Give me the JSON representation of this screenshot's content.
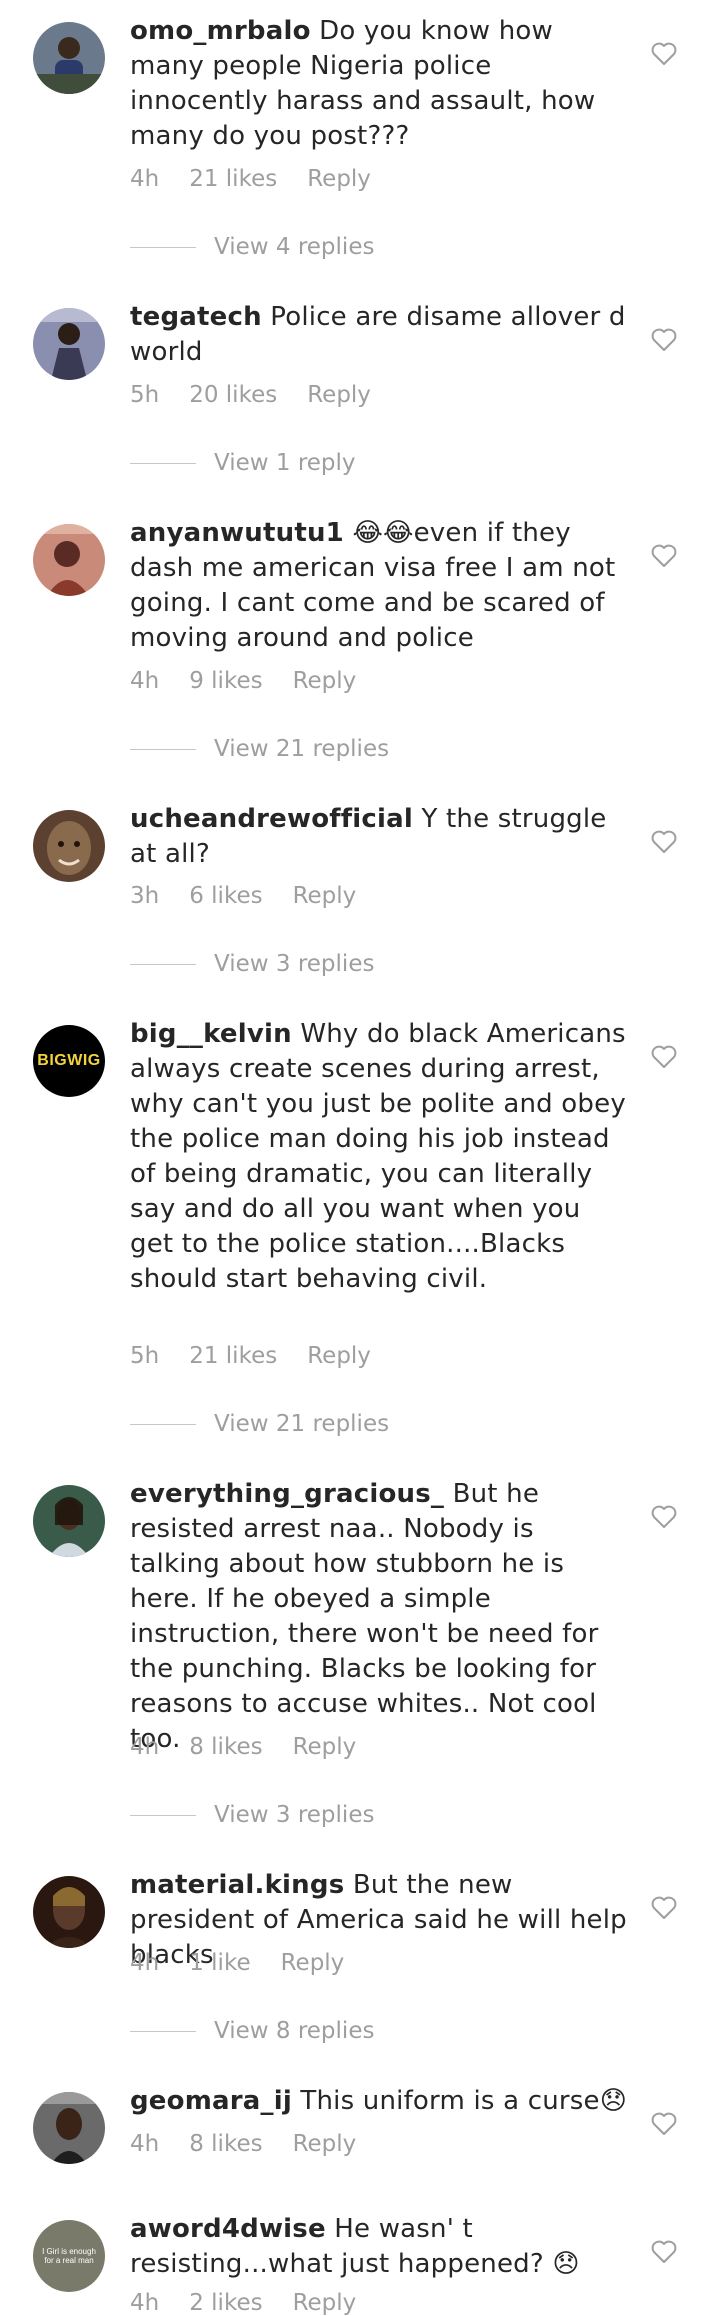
{
  "comments": [
    {
      "username": "omo_mrbalo",
      "text": "Do you know how many people Nigeria police innocently harass and assault, how many do you post???",
      "time": "4h",
      "likes": "21 likes",
      "reply": "Reply",
      "view_replies": "View 4 replies",
      "avatar": {
        "bg": "#6a7a8c",
        "fg": "#2b3a6b"
      }
    },
    {
      "username": "tegatech",
      "text": "Police are disame allover d world",
      "time": "5h",
      "likes": "20 likes",
      "reply": "Reply",
      "view_replies": "View 1 reply",
      "avatar": {
        "bg": "#8a8fb0",
        "fg": "#3b3a55"
      }
    },
    {
      "username": "anyanwututu1",
      "text": "😂😂even if they dash me american visa free I am not going. I cant come and be scared of moving around and police",
      "time": "4h",
      "likes": "9 likes",
      "reply": "Reply",
      "view_replies": "View 21 replies",
      "avatar": {
        "bg": "#c98a7a",
        "fg": "#5a2b25"
      }
    },
    {
      "username": "ucheandrewofficial",
      "text": "Y the struggle at all?",
      "time": "3h",
      "likes": "6 likes",
      "reply": "Reply",
      "view_replies": "View 3 replies",
      "avatar": {
        "bg": "#8a6a4c",
        "fg": "#3a2718"
      }
    },
    {
      "username": "big__kelvin",
      "text": "Why do black Americans always create scenes during arrest, why can't you just be polite and obey the police man doing his job instead of being dramatic, you can literally say and do all you want when you get to the police station....Blacks should start behaving civil.",
      "time": "5h",
      "likes": "21 likes",
      "reply": "Reply",
      "view_replies": "View 21 replies",
      "avatar": {
        "bg": "#000000",
        "fg": "#f2d33b",
        "label": "BIGWIG"
      }
    },
    {
      "username": "everything_gracious_",
      "text": "But he resisted arrest naa.. Nobody is talking about how stubborn he is here. If he obeyed a simple instruction, there won't be need for the punching. Blacks be looking for reasons to accuse whites.. Not cool too.",
      "time": "4h",
      "likes": "8 likes",
      "reply": "Reply",
      "view_replies": "View 3 replies",
      "avatar": {
        "bg": "#3a5a4a",
        "fg": "#1e2b24"
      }
    },
    {
      "username": "material.kings",
      "text": "But the new president of America said he will help blacks",
      "time": "4h",
      "likes": "1 like",
      "reply": "Reply",
      "view_replies": "View 8 replies",
      "avatar": {
        "bg": "#5a3a2a",
        "fg": "#2a1810"
      }
    },
    {
      "username": "geomara_ij",
      "text": "This uniform is a curse😞",
      "time": "4h",
      "likes": "8 likes",
      "reply": "Reply",
      "view_replies": "",
      "avatar": {
        "bg": "#6a6a6a",
        "fg": "#1e1e1e"
      }
    },
    {
      "username": "aword4dwise",
      "text": "He wasn' t resisting...what just happened? 😞",
      "time": "4h",
      "likes": "2 likes",
      "reply": "Reply",
      "view_replies": "",
      "avatar": {
        "bg": "#7a7a6a",
        "fg": "#ffffff",
        "label": "I Girl is enough for a real man"
      }
    }
  ]
}
